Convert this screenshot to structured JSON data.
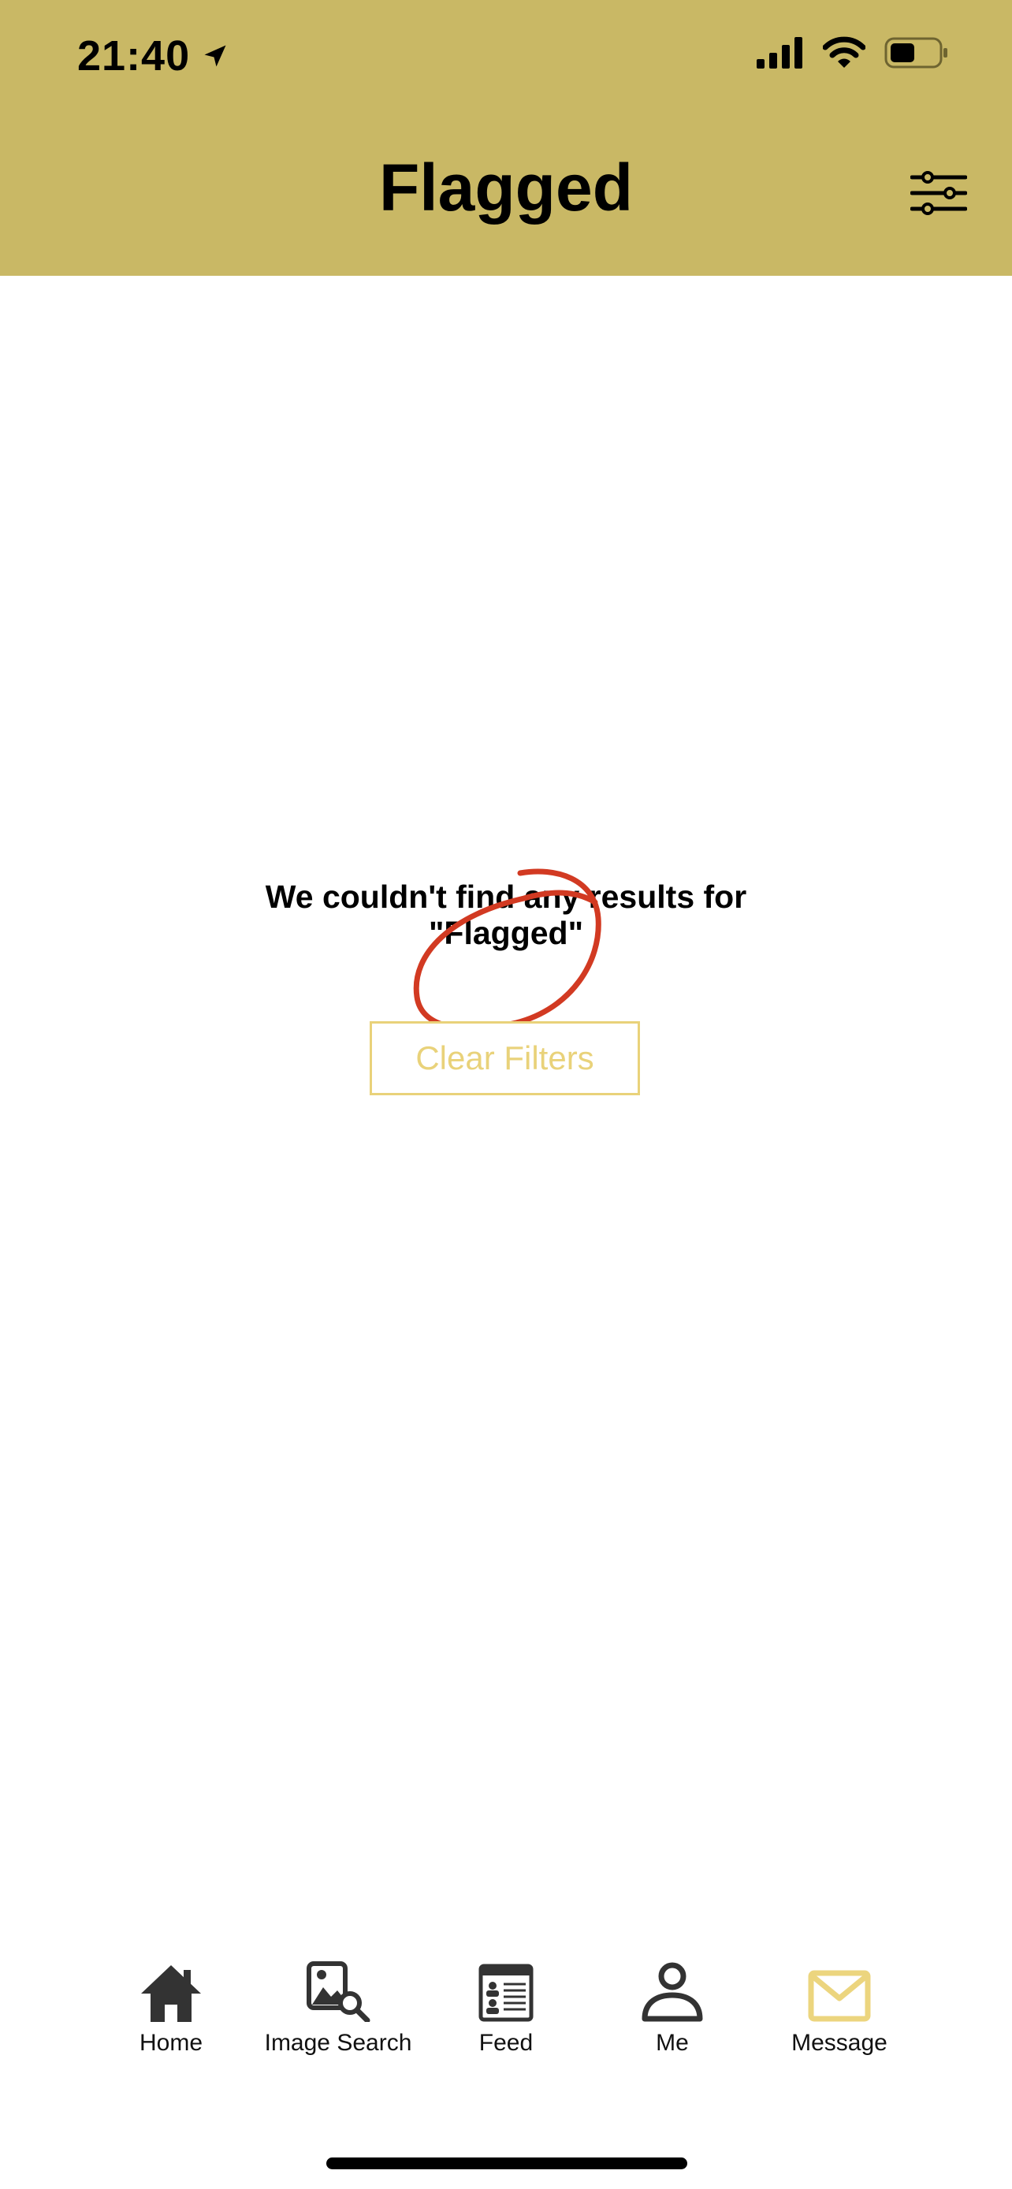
{
  "status_bar": {
    "time": "21:40",
    "icons": [
      "location-arrow-icon",
      "signal-icon",
      "wifi-icon",
      "battery-icon"
    ]
  },
  "header": {
    "title": "Flagged",
    "filter_icon": "sliders-icon",
    "background": "#c9b865"
  },
  "empty_state": {
    "line1": "We couldn't find any results for",
    "line2": "\"Flagged\"",
    "clear_button": "Clear Filters",
    "annotation_color": "#d23a22"
  },
  "tab_bar": {
    "items": [
      {
        "label": "Home",
        "icon": "home-icon",
        "active": false
      },
      {
        "label": "Image Search",
        "icon": "image-search-icon",
        "active": false
      },
      {
        "label": "Feed",
        "icon": "feed-icon",
        "active": false
      },
      {
        "label": "Me",
        "icon": "person-icon",
        "active": false
      },
      {
        "label": "Message",
        "icon": "envelope-icon",
        "active": true
      }
    ],
    "active_color": "#ecd57e",
    "inactive_color": "#333333"
  }
}
